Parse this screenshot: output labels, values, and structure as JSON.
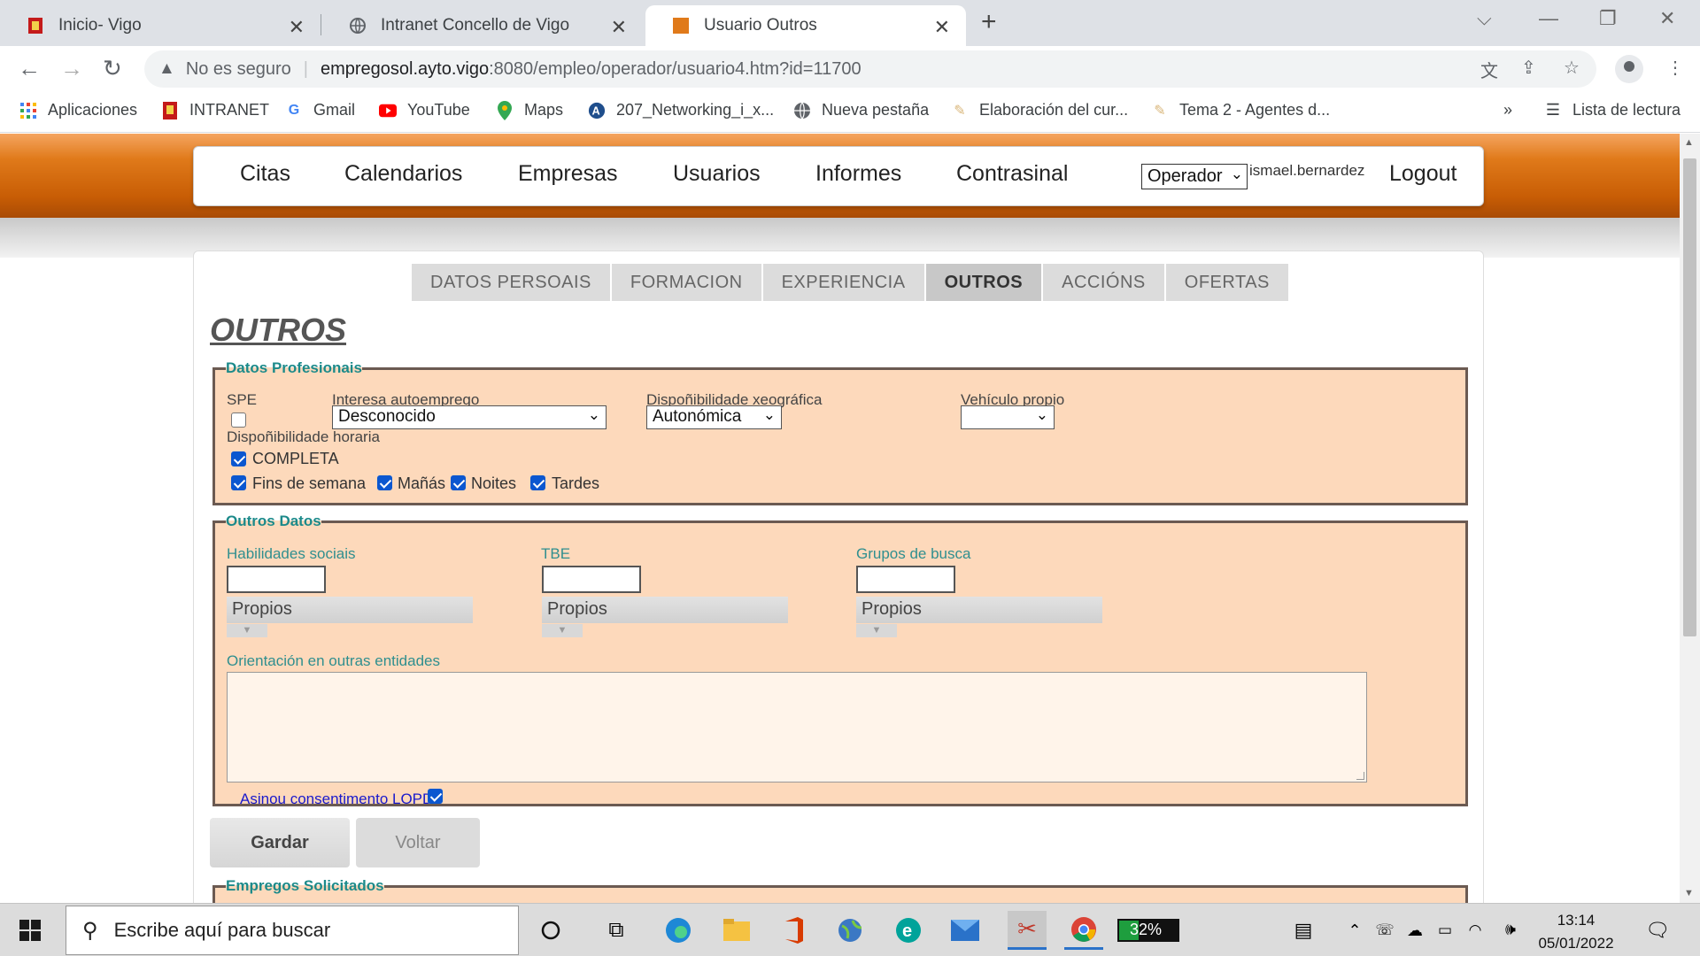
{
  "browser": {
    "tabs": [
      {
        "title": "Inicio- Vigo",
        "active": false
      },
      {
        "title": "Intranet Concello de Vigo",
        "active": false
      },
      {
        "title": "Usuario Outros",
        "active": true
      }
    ],
    "security_label": "No es seguro",
    "url_host": "empregosol.ayto.vigo",
    "url_rest": ":8080/empleo/operador/usuario4.htm?id=11700",
    "bookmarks": [
      "Aplicaciones",
      "INTRANET",
      "Gmail",
      "YouTube",
      "Maps",
      "207_Networking_i_x...",
      "Nueva pestaña",
      "Elaboración del cur...",
      "Tema 2 - Agentes d..."
    ],
    "bookmarks_more": "»",
    "reading_list": "Lista de lectura"
  },
  "nav": {
    "items": [
      "Citas",
      "Calendarios",
      "Empresas",
      "Usuarios",
      "Informes",
      "Contrasinal"
    ],
    "role_selected": "Operador",
    "username": "ismael.bernardez",
    "logout": "Logout"
  },
  "subtabs": [
    "DATOS PERSOAIS",
    "FORMACION",
    "EXPERIENCIA",
    "OUTROS",
    "ACCIÓNS",
    "OFERTAS"
  ],
  "page_title": "OUTROS",
  "datos_profesionais": {
    "legend": "Datos Profesionais",
    "spe_label": "SPE",
    "spe_checked": false,
    "autoemprego_label": "Interesa autoemprego",
    "autoemprego_value": "Desconocido",
    "xeografica_label": "Dispoñibilidade xeográfica",
    "xeografica_value": "Autonómica",
    "vehiculo_label": "Vehículo propio",
    "vehiculo_value": "",
    "horaria_label": "Dispoñibilidade horaria",
    "horaria_options": [
      {
        "label": "COMPLETA",
        "checked": true
      },
      {
        "label": "Fins de semana",
        "checked": true
      },
      {
        "label": "Mañás",
        "checked": true
      },
      {
        "label": "Noites",
        "checked": true
      },
      {
        "label": "Tardes",
        "checked": true
      }
    ]
  },
  "outros_datos": {
    "legend": "Outros Datos",
    "habilidades_label": "Habilidades sociais",
    "tbe_label": "TBE",
    "grupos_label": "Grupos de busca",
    "combo_value": "Propios",
    "orientacion_label": "Orientación en outras entidades",
    "orientacion_value": "",
    "lopd_label": "Asinou consentimento LOPD",
    "lopd_checked": true
  },
  "buttons": {
    "save": "Gardar",
    "back": "Voltar"
  },
  "empregos_legend": "Empregos Solicitados",
  "taskbar": {
    "search_placeholder": "Escribe aquí para buscar",
    "battery": "32%",
    "time": "13:14",
    "date": "05/01/2022"
  }
}
